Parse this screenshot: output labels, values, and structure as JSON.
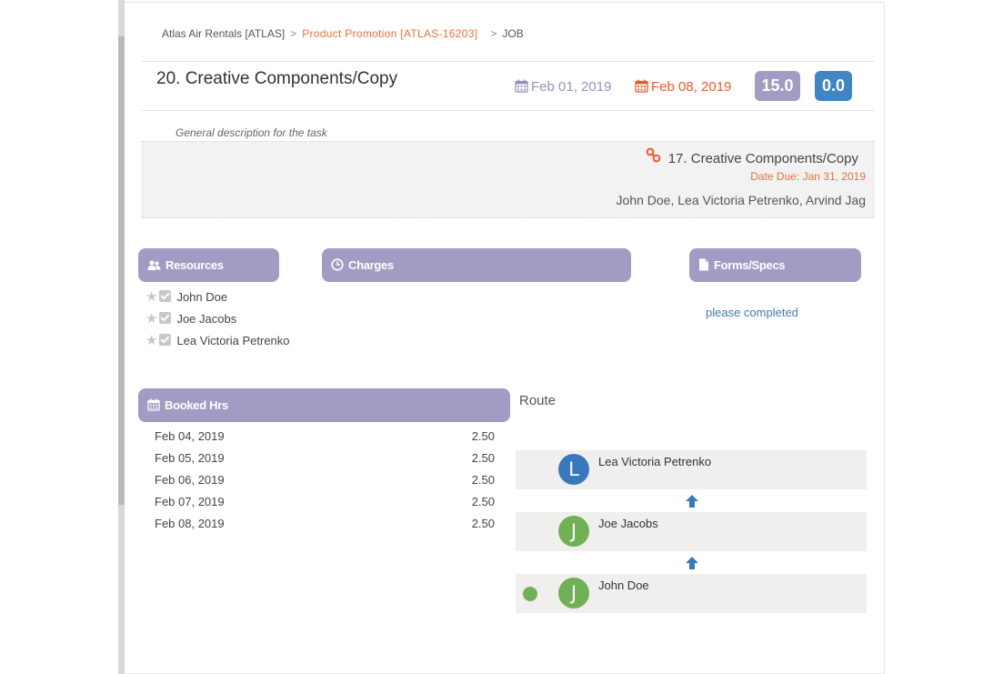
{
  "breadcrumb": {
    "client": "Atlas Air Rentals [ATLAS]",
    "project": "Product Promotion [ATLAS-16203]",
    "current": "JOB",
    "separator": ">"
  },
  "task": {
    "title": "20. Creative Components/Copy",
    "start_date": "Feb 01, 2019",
    "end_date": "Feb 08, 2019",
    "badge_hours": "15.0",
    "badge_actual": "0.0",
    "description": "General description for the task"
  },
  "linked_task": {
    "title": "17. Creative Components/Copy",
    "due": "Date Due: Jan 31, 2019",
    "people": "John Doe, Lea Victoria Petrenko, Arvind Jag"
  },
  "sections": {
    "resources": "Resources",
    "charges": "Charges",
    "forms": "Forms/Specs",
    "booked": "Booked Hrs",
    "route": "Route"
  },
  "resources": [
    {
      "name": "John Doe"
    },
    {
      "name": "Joe Jacobs"
    },
    {
      "name": "Lea Victoria Petrenko"
    }
  ],
  "forms_link": "please completed",
  "booked_hours": [
    {
      "date": "Feb 04, 2019",
      "hours": "2.50"
    },
    {
      "date": "Feb 05, 2019",
      "hours": "2.50"
    },
    {
      "date": "Feb 06, 2019",
      "hours": "2.50"
    },
    {
      "date": "Feb 07, 2019",
      "hours": "2.50"
    },
    {
      "date": "Feb 08, 2019",
      "hours": "2.50"
    }
  ],
  "route": [
    {
      "initial": "L",
      "name": "Lea Victoria Petrenko",
      "color": "#3a78bd"
    },
    {
      "initial": "J",
      "name": "Joe Jacobs",
      "color": "#6fb154"
    },
    {
      "initial": "J",
      "name": "John Doe",
      "color": "#6fb154",
      "current": true
    }
  ],
  "colors": {
    "accent_purple": "#a39bc3",
    "accent_orange": "#ee6f3a",
    "badge_blue": "#3f86c6",
    "route_arrow": "#3a78bd"
  }
}
